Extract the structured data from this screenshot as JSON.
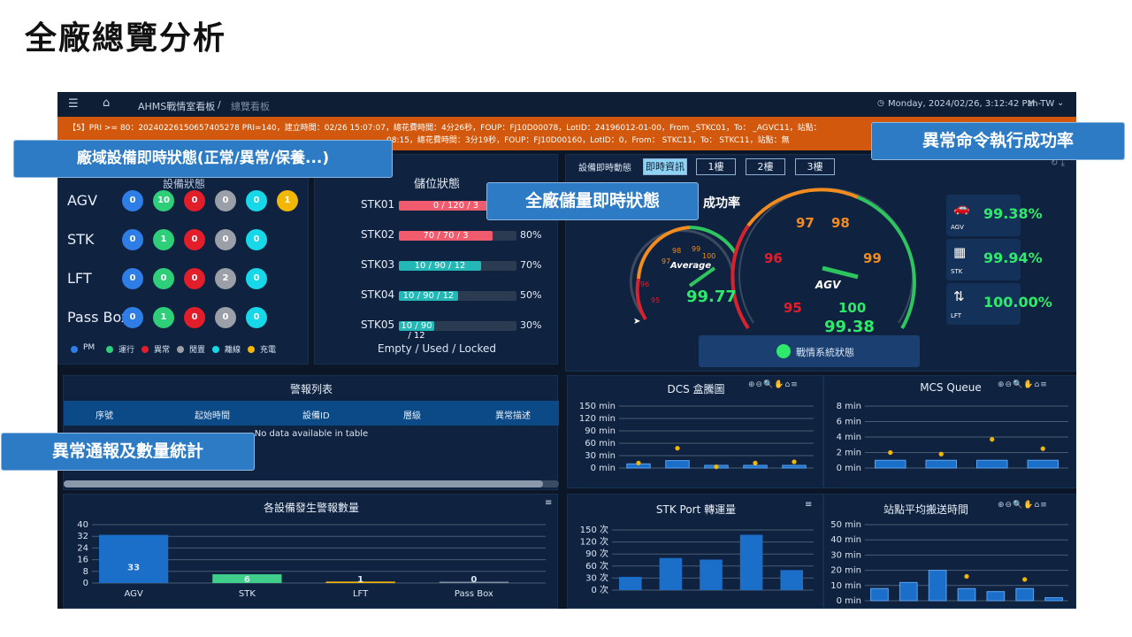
{
  "slide_title": "全廠總覽分析",
  "topbar": {
    "breadcrumb": "AHMS戰情室看板",
    "breadcrumb_sep": "/",
    "breadcrumb_current": "總覽看板",
    "datetime": "Monday, 2024/02/26, 3:12:42 PM",
    "lang": "zh-TW"
  },
  "ticker": {
    "line1": "【5】PRI >= 80：20240226150657405278  PRI=140，建立時間：02/26 15:07:07，總花費時間：4分26秒，FOUP：FJ10D00078，LotID：24196012-01-00，From    _STKC01，To：    _AGVC11，站點：",
    "line2": "08:15，總花費時間：3分19秒，FOUP：FJ10D00160，LotID：0，From：    STKC11，To：    STKC11，站點：無"
  },
  "callouts": {
    "equip": "廠域設備即時狀態(正常/異常/保養...)",
    "storage": "全廠儲量即時狀態",
    "success": "異常命令執行成功率",
    "alarm": "異常通報及數量統計"
  },
  "device_status": {
    "title": "設備狀態",
    "rows": [
      {
        "name": "AGV",
        "values": [
          "0",
          "10",
          "0",
          "0",
          "0",
          "1"
        ]
      },
      {
        "name": "STK",
        "values": [
          "0",
          "1",
          "0",
          "0",
          "0"
        ]
      },
      {
        "name": "LFT",
        "values": [
          "0",
          "0",
          "0",
          "2",
          "0"
        ]
      },
      {
        "name": "Pass Box",
        "values": [
          "0",
          "1",
          "0",
          "0",
          "0"
        ]
      }
    ],
    "legend": [
      "PM",
      "運行",
      "異常",
      "閒置",
      "離線",
      "充電"
    ],
    "colors": [
      "#2f7de6",
      "#2fcf7a",
      "#e21e2a",
      "#9a9fa8",
      "#16d8e8",
      "#f2b705"
    ]
  },
  "storage": {
    "title": "儲位狀態",
    "rows": [
      {
        "name": "STK01",
        "text": "0 / 120 / 3",
        "pct": "",
        "fill": 0.97,
        "color": "#f05c6e"
      },
      {
        "name": "STK02",
        "text": "70 / 70 / 3",
        "pct": "80%",
        "fill": 0.8,
        "color": "#f05c6e"
      },
      {
        "name": "STK03",
        "text": "10 / 90 / 12",
        "pct": "70%",
        "fill": 0.7,
        "color": "#23b7b5"
      },
      {
        "name": "STK04",
        "text": "10 / 90 / 12",
        "pct": "50%",
        "fill": 0.5,
        "color": "#23b7b5"
      },
      {
        "name": "STK05",
        "text": "10 / 90 / 12",
        "pct": "30%",
        "fill": 0.3,
        "color": "#23b7b5"
      }
    ],
    "footer": "Empty / Used / Locked"
  },
  "success": {
    "status_label": "設備即時動態",
    "tabs": [
      "即時資訊",
      "1樓",
      "2樓",
      "3樓"
    ],
    "title_partial": "成功率",
    "avg_gauge": {
      "label": "Average",
      "value": "99.77",
      "ticks": [
        "95",
        "96",
        "97",
        "98",
        "99",
        "100"
      ]
    },
    "agv_gauge": {
      "label": "AGV",
      "value": "99.38",
      "ticks": [
        "95",
        "96",
        "97",
        "98",
        "99",
        "100"
      ]
    },
    "stats": [
      {
        "name": "AGV",
        "value": "99.38%"
      },
      {
        "name": "STK",
        "value": "99.94%"
      },
      {
        "name": "LFT",
        "value": "100.00%"
      }
    ],
    "system_status": "戰情系統狀態"
  },
  "alarm_list": {
    "title": "警報列表",
    "columns": [
      "序號",
      "起始時間",
      "設備ID",
      "層級",
      "異常描述"
    ],
    "empty": "No data available in table"
  },
  "chart_data": [
    {
      "type": "bar",
      "title": "各設備發生警報數量",
      "categories": [
        "AGV",
        "STK",
        "LFT",
        "Pass Box"
      ],
      "values": [
        33,
        6,
        1,
        0
      ],
      "ylim": [
        0,
        40
      ],
      "yticks": [
        "40",
        "32",
        "24",
        "16",
        "8",
        "0"
      ],
      "colors": [
        "#1b6fc9",
        "#3fcf8a",
        "#f2b705",
        "#7f8ea3"
      ]
    },
    {
      "type": "box",
      "title": "DCS 盒騰圖",
      "yticks": [
        "150 min",
        "120 min",
        "90 min",
        "60 min",
        "30 min",
        "0 min"
      ],
      "ylim": [
        0,
        150
      ],
      "medians": [
        10,
        18,
        3,
        4,
        6
      ],
      "outliers": [
        12,
        48,
        3,
        12,
        15
      ]
    },
    {
      "type": "box",
      "title": "MCS Queue",
      "yticks": [
        "8 min",
        "6 min",
        "4 min",
        "2 min",
        "0 min"
      ],
      "ylim": [
        0,
        8
      ],
      "medians": [
        1,
        1,
        1,
        1
      ],
      "outliers": [
        2,
        1.8,
        3.7,
        2.5
      ]
    },
    {
      "type": "bar",
      "title": "STK Port 轉運量",
      "yticks": [
        "150 次",
        "120 次",
        "90 次",
        "60 次",
        "30 次",
        "0 次"
      ],
      "ylim": [
        0,
        150
      ],
      "values": [
        33,
        80,
        76,
        138,
        50
      ]
    },
    {
      "type": "box",
      "title": "站點平均搬送時間",
      "yticks": [
        "50 min",
        "40 min",
        "30 min",
        "20 min",
        "10 min",
        "0 min"
      ],
      "ylim": [
        0,
        50
      ],
      "medians": [
        8,
        12,
        20,
        8,
        6,
        8,
        2
      ],
      "outliers": [
        0,
        0,
        0,
        16,
        0,
        14,
        0
      ]
    }
  ]
}
